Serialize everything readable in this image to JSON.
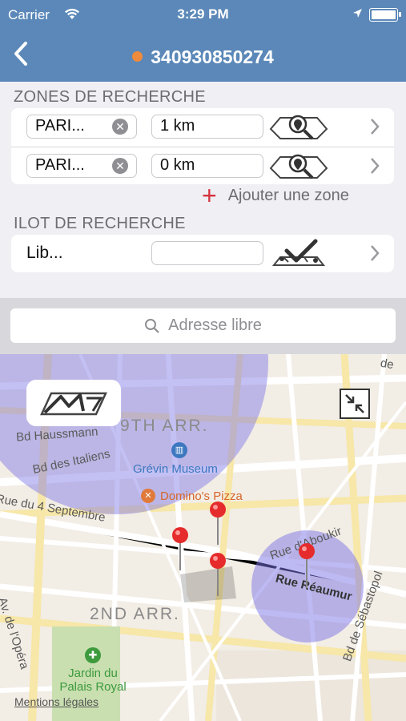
{
  "status_bar": {
    "carrier": "Carrier",
    "time": "3:29 PM"
  },
  "nav": {
    "title": "340930850274",
    "back_icon": "chevron-left-icon",
    "dot_color": "#f08a3c"
  },
  "zones": {
    "label": "ZONES DE RECHERCHE",
    "rows": [
      {
        "place": "PARI...",
        "radius": "1 km"
      },
      {
        "place": "PARI...",
        "radius": "0 km"
      }
    ],
    "add_label": "Ajouter une zone"
  },
  "ilot": {
    "label": "ILOT DE RECHERCHE",
    "value": "Lib...",
    "field": ""
  },
  "search": {
    "placeholder": "Adresse libre"
  },
  "map": {
    "labels": {
      "arr9": "9TH ARR.",
      "arr2": "2ND ARR.",
      "haussmann": "Bd Haussmann",
      "italiens": "Bd des Italiens",
      "septembre": "Rue du 4 Septembre",
      "opera": "Av. de l'Opéra",
      "reaumur": "Rue Réaumur",
      "aboukir": "Rue d'Aboukir",
      "sebastopol": "Bd de Sébastopol",
      "grevin": "Grévin Museum",
      "dominos": "Domino's Pizza",
      "jardin": "Jardin du Palais Royal",
      "top_right": "de",
      "legal": "Mentions légales"
    },
    "zone_color": "#7b73e6"
  }
}
